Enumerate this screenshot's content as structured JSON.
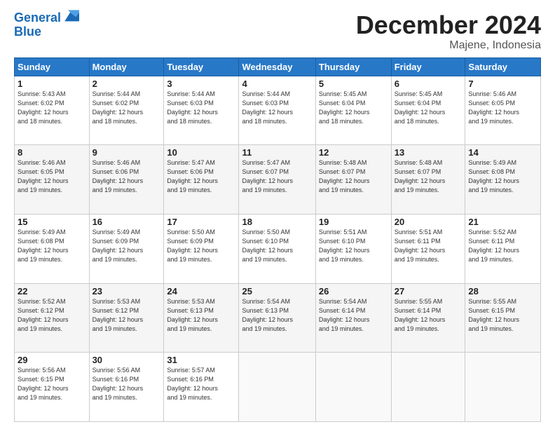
{
  "header": {
    "logo_line1": "General",
    "logo_line2": "Blue",
    "month_title": "December 2024",
    "location": "Majene, Indonesia"
  },
  "weekdays": [
    "Sunday",
    "Monday",
    "Tuesday",
    "Wednesday",
    "Thursday",
    "Friday",
    "Saturday"
  ],
  "weeks": [
    [
      {
        "day": "1",
        "rise": "5:43 AM",
        "set": "6:02 PM",
        "hours": "12 hours and 18 minutes."
      },
      {
        "day": "2",
        "rise": "5:44 AM",
        "set": "6:02 PM",
        "hours": "12 hours and 18 minutes."
      },
      {
        "day": "3",
        "rise": "5:44 AM",
        "set": "6:03 PM",
        "hours": "12 hours and 18 minutes."
      },
      {
        "day": "4",
        "rise": "5:44 AM",
        "set": "6:03 PM",
        "hours": "12 hours and 18 minutes."
      },
      {
        "day": "5",
        "rise": "5:45 AM",
        "set": "6:04 PM",
        "hours": "12 hours and 18 minutes."
      },
      {
        "day": "6",
        "rise": "5:45 AM",
        "set": "6:04 PM",
        "hours": "12 hours and 18 minutes."
      },
      {
        "day": "7",
        "rise": "5:46 AM",
        "set": "6:05 PM",
        "hours": "12 hours and 19 minutes."
      }
    ],
    [
      {
        "day": "8",
        "rise": "5:46 AM",
        "set": "6:05 PM",
        "hours": "12 hours and 19 minutes."
      },
      {
        "day": "9",
        "rise": "5:46 AM",
        "set": "6:06 PM",
        "hours": "12 hours and 19 minutes."
      },
      {
        "day": "10",
        "rise": "5:47 AM",
        "set": "6:06 PM",
        "hours": "12 hours and 19 minutes."
      },
      {
        "day": "11",
        "rise": "5:47 AM",
        "set": "6:07 PM",
        "hours": "12 hours and 19 minutes."
      },
      {
        "day": "12",
        "rise": "5:48 AM",
        "set": "6:07 PM",
        "hours": "12 hours and 19 minutes."
      },
      {
        "day": "13",
        "rise": "5:48 AM",
        "set": "6:07 PM",
        "hours": "12 hours and 19 minutes."
      },
      {
        "day": "14",
        "rise": "5:49 AM",
        "set": "6:08 PM",
        "hours": "12 hours and 19 minutes."
      }
    ],
    [
      {
        "day": "15",
        "rise": "5:49 AM",
        "set": "6:08 PM",
        "hours": "12 hours and 19 minutes."
      },
      {
        "day": "16",
        "rise": "5:49 AM",
        "set": "6:09 PM",
        "hours": "12 hours and 19 minutes."
      },
      {
        "day": "17",
        "rise": "5:50 AM",
        "set": "6:09 PM",
        "hours": "12 hours and 19 minutes."
      },
      {
        "day": "18",
        "rise": "5:50 AM",
        "set": "6:10 PM",
        "hours": "12 hours and 19 minutes."
      },
      {
        "day": "19",
        "rise": "5:51 AM",
        "set": "6:10 PM",
        "hours": "12 hours and 19 minutes."
      },
      {
        "day": "20",
        "rise": "5:51 AM",
        "set": "6:11 PM",
        "hours": "12 hours and 19 minutes."
      },
      {
        "day": "21",
        "rise": "5:52 AM",
        "set": "6:11 PM",
        "hours": "12 hours and 19 minutes."
      }
    ],
    [
      {
        "day": "22",
        "rise": "5:52 AM",
        "set": "6:12 PM",
        "hours": "12 hours and 19 minutes."
      },
      {
        "day": "23",
        "rise": "5:53 AM",
        "set": "6:12 PM",
        "hours": "12 hours and 19 minutes."
      },
      {
        "day": "24",
        "rise": "5:53 AM",
        "set": "6:13 PM",
        "hours": "12 hours and 19 minutes."
      },
      {
        "day": "25",
        "rise": "5:54 AM",
        "set": "6:13 PM",
        "hours": "12 hours and 19 minutes."
      },
      {
        "day": "26",
        "rise": "5:54 AM",
        "set": "6:14 PM",
        "hours": "12 hours and 19 minutes."
      },
      {
        "day": "27",
        "rise": "5:55 AM",
        "set": "6:14 PM",
        "hours": "12 hours and 19 minutes."
      },
      {
        "day": "28",
        "rise": "5:55 AM",
        "set": "6:15 PM",
        "hours": "12 hours and 19 minutes."
      }
    ],
    [
      {
        "day": "29",
        "rise": "5:56 AM",
        "set": "6:15 PM",
        "hours": "12 hours and 19 minutes."
      },
      {
        "day": "30",
        "rise": "5:56 AM",
        "set": "6:16 PM",
        "hours": "12 hours and 19 minutes."
      },
      {
        "day": "31",
        "rise": "5:57 AM",
        "set": "6:16 PM",
        "hours": "12 hours and 19 minutes."
      },
      null,
      null,
      null,
      null
    ]
  ]
}
